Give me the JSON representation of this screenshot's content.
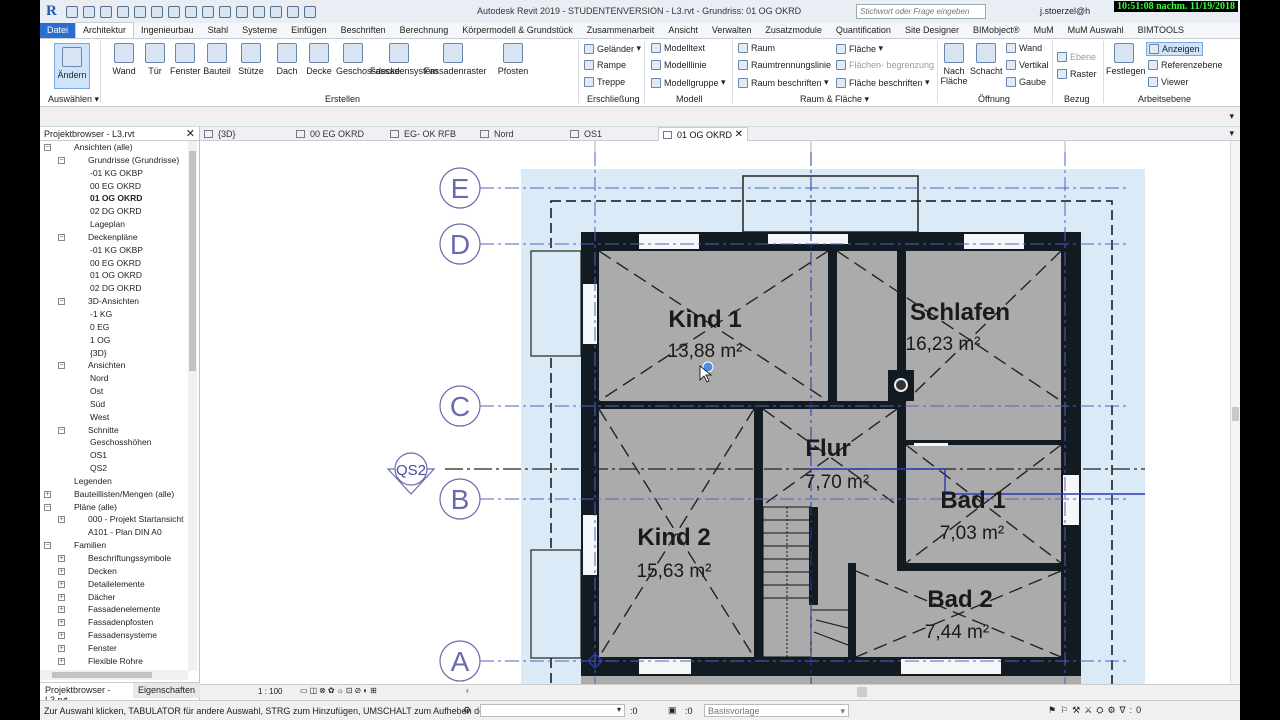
{
  "app": {
    "title": "Autodesk Revit 2019 - STUDENTENVERSION - L3.rvt - Grundriss: 01 OG OKRD",
    "search_placeholder": "Stichwort oder Frage eingeben",
    "user": "j.stoerzel@h",
    "clock": "10:51:08 nachm. 11/19/2018",
    "logo": "R"
  },
  "ribbon_tabs": [
    "Datei",
    "Architektur",
    "Ingenieurbau",
    "Stahl",
    "Systeme",
    "Einfügen",
    "Beschriften",
    "Berechnung",
    "Körpermodell & Grundstück",
    "Zusammenarbeit",
    "Ansicht",
    "Verwalten",
    "Zusatzmodule",
    "Quantification",
    "Site Designer",
    "BIMobject®",
    "MuM",
    "MuM Auswahl",
    "BIMTOOLS"
  ],
  "ribbon": {
    "modify": "Ändern",
    "select": "Auswählen",
    "build": [
      "Wand",
      "Tür",
      "Fenster",
      "Bauteil",
      "Stütze",
      "Dach",
      "Decke",
      "Geschossdecke",
      "Fassadensystem",
      "Fassadenraster",
      "Pfosten"
    ],
    "build_panel": "Erstellen",
    "circulation": [
      "Geländer",
      "Rampe",
      "Treppe"
    ],
    "circulation_panel": "Erschließung",
    "model": [
      "Modelltext",
      "Modelllinie",
      "Modellgruppe"
    ],
    "model_panel": "Modell",
    "room": [
      "Raum",
      "Raumtrennungslinie",
      "Raum beschriften",
      "Fläche",
      "Flächen- begrenzung",
      "Fläche beschriften"
    ],
    "room_panel": "Raum & Fläche",
    "opening_big": [
      "Nach Fläche",
      "Schacht"
    ],
    "opening": [
      "Wand",
      "Vertikal",
      "Gaube"
    ],
    "opening_panel": "Öffnung",
    "datum": [
      "Ebene",
      "Raster"
    ],
    "datum_panel": "Bezug",
    "workplane_big": "Festlegen",
    "workplane": [
      "Anzeigen",
      "Referenzebene",
      "Viewer"
    ],
    "workplane_panel": "Arbeitsebene"
  },
  "browser": {
    "title": "Projektbrowser - L3.rvt",
    "tabs": [
      "Projektbrowser - L3.rvt",
      "Eigenschaften"
    ],
    "items": [
      {
        "label": "Ansichten (alle)",
        "level": 0,
        "exp": "−"
      },
      {
        "label": "Grundrisse (Grundrisse)",
        "level": 1,
        "exp": "−"
      },
      {
        "label": "-01 KG OKBP",
        "level": 2
      },
      {
        "label": "00 EG OKRD",
        "level": 2
      },
      {
        "label": "01 OG OKRD",
        "level": 2,
        "bold": true
      },
      {
        "label": "02 DG OKRD",
        "level": 2
      },
      {
        "label": "Lageplan",
        "level": 2
      },
      {
        "label": "Deckenpläne",
        "level": 1,
        "exp": "−"
      },
      {
        "label": "-01 KG OKBP",
        "level": 2
      },
      {
        "label": "00 EG OKRD",
        "level": 2
      },
      {
        "label": "01 OG OKRD",
        "level": 2
      },
      {
        "label": "02 DG OKRD",
        "level": 2
      },
      {
        "label": "3D-Ansichten",
        "level": 1,
        "exp": "−"
      },
      {
        "label": "-1 KG",
        "level": 2
      },
      {
        "label": "0 EG",
        "level": 2
      },
      {
        "label": "1 OG",
        "level": 2
      },
      {
        "label": "{3D}",
        "level": 2
      },
      {
        "label": "Ansichten",
        "level": 1,
        "exp": "−"
      },
      {
        "label": "Nord",
        "level": 2
      },
      {
        "label": "Ost",
        "level": 2
      },
      {
        "label": "Süd",
        "level": 2
      },
      {
        "label": "West",
        "level": 2
      },
      {
        "label": "Schnitte",
        "level": 1,
        "exp": "−"
      },
      {
        "label": "Geschosshöhen",
        "level": 2
      },
      {
        "label": "OS1",
        "level": 2
      },
      {
        "label": "QS2",
        "level": 2
      },
      {
        "label": "Legenden",
        "level": 0
      },
      {
        "label": "Bauteillisten/Mengen (alle)",
        "level": 0,
        "exp": "+"
      },
      {
        "label": "Pläne (alle)",
        "level": 0,
        "exp": "−"
      },
      {
        "label": "000 - Projekt Startansicht",
        "level": 1,
        "exp": "+"
      },
      {
        "label": "A101 - Plan DIN A0",
        "level": 1
      },
      {
        "label": "Familien",
        "level": 0,
        "exp": "−"
      },
      {
        "label": "Beschriftungssymbole",
        "level": 1,
        "exp": "+"
      },
      {
        "label": "Decken",
        "level": 1,
        "exp": "+"
      },
      {
        "label": "Detailelemente",
        "level": 1,
        "exp": "+"
      },
      {
        "label": "Dächer",
        "level": 1,
        "exp": "+"
      },
      {
        "label": "Fassadenelemente",
        "level": 1,
        "exp": "+"
      },
      {
        "label": "Fassadenpfosten",
        "level": 1,
        "exp": "+"
      },
      {
        "label": "Fassadensysteme",
        "level": 1,
        "exp": "+"
      },
      {
        "label": "Fenster",
        "level": 1,
        "exp": "+"
      },
      {
        "label": "Flexible Rohre",
        "level": 1,
        "exp": "+"
      }
    ]
  },
  "view_tabs": [
    "{3D}",
    "00 EG OKRD",
    "EG- OK RFB",
    "Nord",
    "OS1",
    "01 OG OKRD"
  ],
  "rooms": [
    {
      "name": "Kind 1",
      "area": "13,88 m²"
    },
    {
      "name": "Schlafen",
      "area": "16,23 m²"
    },
    {
      "name": "Flur",
      "area": "7,70 m²"
    },
    {
      "name": "Bad 1",
      "area": "7,03 m²"
    },
    {
      "name": "Kind 2",
      "area": "15,63 m²"
    },
    {
      "name": "Bad 2",
      "area": "7,44 m²"
    }
  ],
  "grids": [
    "E",
    "D",
    "C",
    "B",
    "A"
  ],
  "section_tag": "QS2",
  "view_scale": "1 : 100",
  "status": {
    "hint": "Zur Auswahl klicken, TABULATOR für andere Auswahl, STRG zum Hinzufügen, UMSCHALT zum Aufheben der",
    "count": ":0",
    "filter": ":0",
    "template": "Basisvorlage"
  }
}
